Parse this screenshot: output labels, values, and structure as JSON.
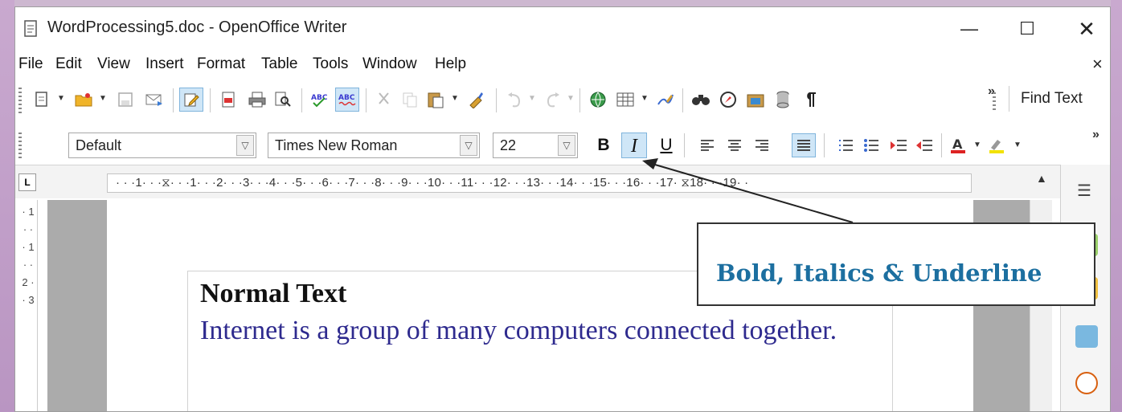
{
  "window": {
    "title": "WordProcessing5.doc - OpenOffice Writer",
    "minimize": "—",
    "maximize": "☐",
    "close": "✕"
  },
  "menu": {
    "items": [
      "File",
      "Edit",
      "View",
      "Insert",
      "Format",
      "Table",
      "Tools",
      "Window",
      "Help"
    ],
    "doc_close": "×"
  },
  "toolbar_standard": {
    "find_text": "Find Text",
    "more": "»"
  },
  "toolbar_formatting": {
    "paragraph_style": "Default",
    "font_name": "Times New Roman",
    "font_size": "22",
    "bold_label": "B",
    "italic_label": "I",
    "underline_label": "U",
    "more": "»"
  },
  "ruler": {
    "ticks": "· · ·1· · ·⧖· · ·1· · ·2· · ·3· · ·4· · ·5· · ·6· · ·7· · ·8· · ·9· · ·10· · ·11· · ·12· · ·13· · ·14· · ·15· · ·16· · ·17· ⧖18· · ·19· ·",
    "corner": "L",
    "vertical": "· 1 · · · 1 · · 2 · · 3"
  },
  "document": {
    "heading": "Normal Text",
    "paragraph": "Internet is a group of many computers connected together."
  },
  "callout": {
    "text": "Bold, Italics & Underline"
  },
  "colors": {
    "paragraph_text": "#2e2a8e",
    "callout_text": "#1c6fa0",
    "pressed_button": "#cfe6f7"
  }
}
